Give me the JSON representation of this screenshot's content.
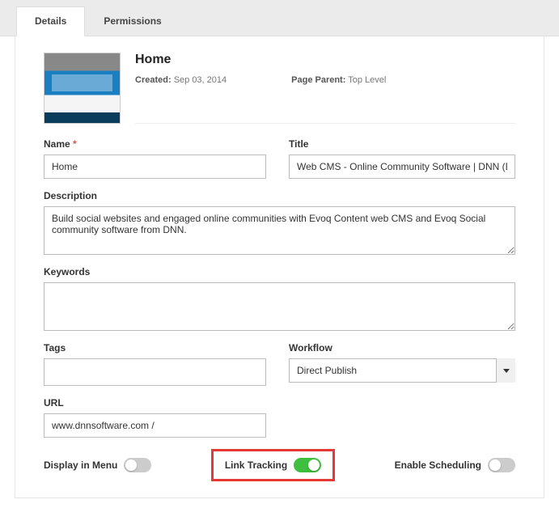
{
  "tabs": {
    "details": "Details",
    "permissions": "Permissions"
  },
  "header": {
    "title": "Home",
    "created_label": "Created:",
    "created_value": "Sep 03, 2014",
    "parent_label": "Page Parent:",
    "parent_value": "Top Level"
  },
  "fields": {
    "name_label": "Name",
    "name_value": "Home",
    "title_label": "Title",
    "title_value": "Web CMS - Online Community Software | DNN (DotNetNuke)",
    "description_label": "Description",
    "description_value": "Build social websites and engaged online communities with Evoq Content web CMS and Evoq Social community software from DNN.",
    "keywords_label": "Keywords",
    "keywords_value": "",
    "tags_label": "Tags",
    "tags_value": "",
    "workflow_label": "Workflow",
    "workflow_value": "Direct Publish",
    "url_label": "URL",
    "url_value": "www.dnnsoftware.com /"
  },
  "toggles": {
    "display_in_menu_label": "Display in Menu",
    "display_in_menu": false,
    "link_tracking_label": "Link Tracking",
    "link_tracking": true,
    "enable_scheduling_label": "Enable Scheduling",
    "enable_scheduling": false
  }
}
